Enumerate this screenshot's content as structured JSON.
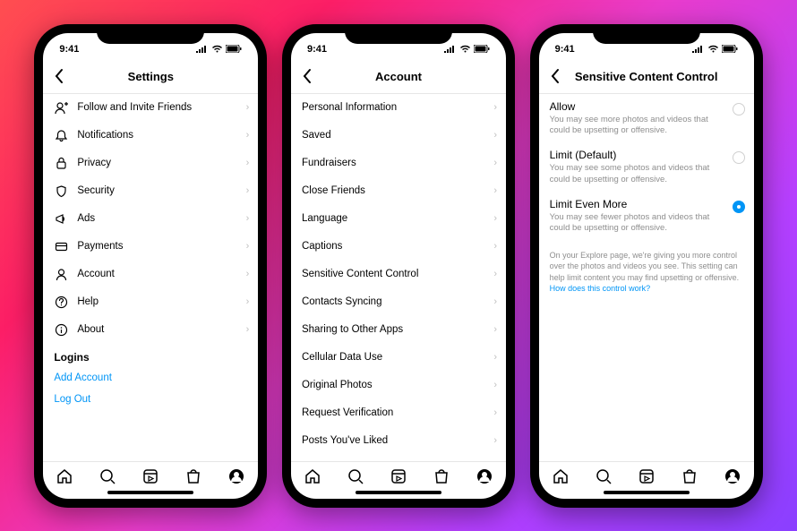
{
  "status": {
    "time": "9:41"
  },
  "phone1": {
    "title": "Settings",
    "items": [
      {
        "label": "Follow and Invite Friends"
      },
      {
        "label": "Notifications"
      },
      {
        "label": "Privacy"
      },
      {
        "label": "Security"
      },
      {
        "label": "Ads"
      },
      {
        "label": "Payments"
      },
      {
        "label": "Account"
      },
      {
        "label": "Help"
      },
      {
        "label": "About"
      }
    ],
    "logins_header": "Logins",
    "add_account": "Add Account",
    "log_out": "Log Out"
  },
  "phone2": {
    "title": "Account",
    "items": [
      {
        "label": "Personal Information"
      },
      {
        "label": "Saved"
      },
      {
        "label": "Fundraisers"
      },
      {
        "label": "Close Friends"
      },
      {
        "label": "Language"
      },
      {
        "label": "Captions"
      },
      {
        "label": "Sensitive Content Control"
      },
      {
        "label": "Contacts Syncing"
      },
      {
        "label": "Sharing to Other Apps"
      },
      {
        "label": "Cellular Data Use"
      },
      {
        "label": "Original Photos"
      },
      {
        "label": "Request Verification"
      },
      {
        "label": "Posts You've Liked"
      }
    ]
  },
  "phone3": {
    "title": "Sensitive Content Control",
    "options": [
      {
        "title": "Allow",
        "desc": "You may see more photos and videos that could be upsetting or offensive.",
        "selected": false
      },
      {
        "title": "Limit (Default)",
        "desc": "You may see some photos and videos that could be upsetting or offensive.",
        "selected": false
      },
      {
        "title": "Limit Even More",
        "desc": "You may see fewer photos and videos that could be upsetting or offensive.",
        "selected": true
      }
    ],
    "explain_text": "On your Explore page, we're giving you more control over the photos and videos you see. This setting can help limit content you may find upsetting or offensive. ",
    "explain_link": "How does this control work?"
  }
}
